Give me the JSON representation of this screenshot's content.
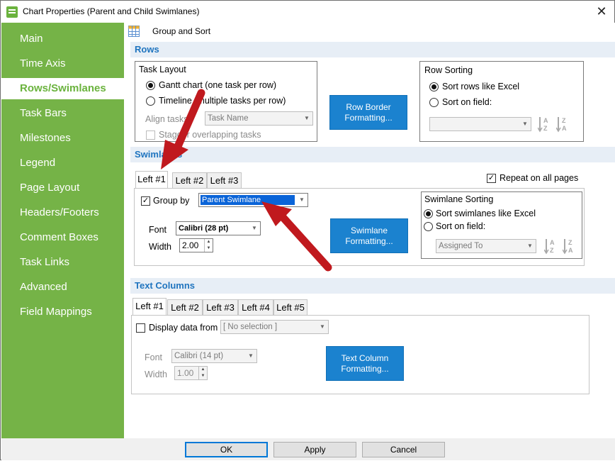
{
  "window": {
    "title": "Chart Properties (Parent and Child Swimlanes)",
    "close_glyph": "✕"
  },
  "sidebar": {
    "items": [
      {
        "label": "Main"
      },
      {
        "label": "Time Axis"
      },
      {
        "label": "Rows/Swimlanes"
      },
      {
        "label": "Task Bars"
      },
      {
        "label": "Milestones"
      },
      {
        "label": "Legend"
      },
      {
        "label": "Page Layout"
      },
      {
        "label": "Headers/Footers"
      },
      {
        "label": "Comment Boxes"
      },
      {
        "label": "Task Links"
      },
      {
        "label": "Advanced"
      },
      {
        "label": "Field Mappings"
      }
    ],
    "active": "Rows/Swimlanes"
  },
  "toolbar": {
    "group_sort_label": "Group and Sort"
  },
  "rows": {
    "section_title": "Rows",
    "task_layout": {
      "title": "Task Layout",
      "option_gantt": "Gantt chart (one task per row)",
      "option_timeline": "Timeline (multiple tasks per row)",
      "align_label": "Align tasks",
      "align_value": "Task Name",
      "stagger_label": "Stagger overlapping tasks"
    },
    "border_button": "Row Border Formatting...",
    "row_sorting": {
      "title": "Row Sorting",
      "option_excel": "Sort rows like Excel",
      "option_field": "Sort on field:",
      "field_value": "",
      "az": "A Z",
      "za": "Z A"
    }
  },
  "swimlanes": {
    "section_title": "Swimlanes",
    "tabs": [
      "Left #1",
      "Left #2",
      "Left #3"
    ],
    "repeat_label": "Repeat on all pages",
    "group_by_label": "Group by",
    "group_by_value": "Parent Swimlane",
    "font_label": "Font",
    "font_value": "Calibri (28 pt)",
    "width_label": "Width",
    "width_value": "2.00",
    "format_button": "Swimlane Formatting...",
    "sorting": {
      "title": "Swimlane Sorting",
      "option_excel": "Sort swimlanes like Excel",
      "option_field": "Sort on field:",
      "field_value": "Assigned To"
    }
  },
  "text_columns": {
    "section_title": "Text Columns",
    "tabs": [
      "Left #1",
      "Left #2",
      "Left #3",
      "Left #4",
      "Left #5"
    ],
    "display_label": "Display data from",
    "display_value": "[ No selection ]",
    "font_label": "Font",
    "font_value": "Calibri (14 pt)",
    "width_label": "Width",
    "width_value": "1.00",
    "format_button": "Text Column Formatting..."
  },
  "footer": {
    "ok": "OK",
    "apply": "Apply",
    "cancel": "Cancel"
  },
  "colors": {
    "sidebar": "#75b347",
    "accent": "#1b82cf",
    "section_text": "#1f74bf",
    "arrow": "#c0191e"
  }
}
